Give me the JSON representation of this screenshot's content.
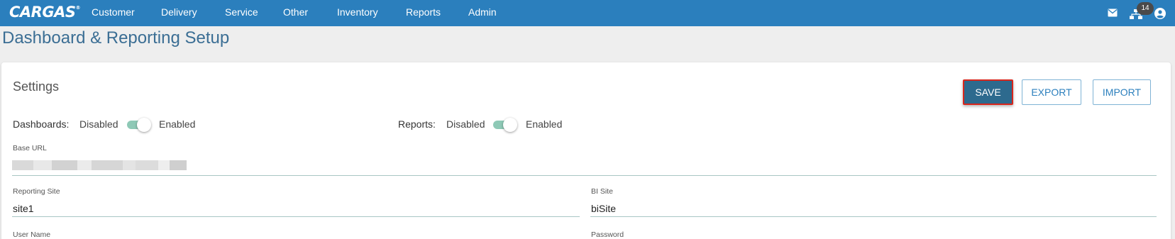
{
  "brand": {
    "name": "CARGAS",
    "mark": "®"
  },
  "nav": [
    {
      "label": "Customer"
    },
    {
      "label": "Delivery"
    },
    {
      "label": "Service"
    },
    {
      "label": "Other"
    },
    {
      "label": "Inventory"
    },
    {
      "label": "Reports"
    },
    {
      "label": "Admin"
    }
  ],
  "topbar": {
    "notification_count": "14",
    "icons": [
      "mail-icon",
      "sitemap-icon",
      "account-circle-icon"
    ]
  },
  "page": {
    "title": "Dashboard & Reporting Setup"
  },
  "settings": {
    "title": "Settings",
    "buttons": {
      "save": "SAVE",
      "export": "EXPORT",
      "import": "IMPORT"
    },
    "dashboards": {
      "label": "Dashboards:",
      "off": "Disabled",
      "on": "Enabled",
      "enabled": true
    },
    "reports": {
      "label": "Reports:",
      "off": "Disabled",
      "on": "Enabled",
      "enabled": true
    },
    "fields": {
      "base_url": {
        "label": "Base URL",
        "value": ""
      },
      "reporting_site": {
        "label": "Reporting Site",
        "value": "site1"
      },
      "bi_site": {
        "label": "BI Site",
        "value": "biSite"
      },
      "user_name": {
        "label": "User Name",
        "value": ""
      },
      "password": {
        "label": "Password",
        "value": ""
      }
    }
  },
  "colors": {
    "topbar": "#2b7fbd",
    "title": "#3b6e94",
    "save_button": "#2d6a8e",
    "highlight_border": "#d9261c",
    "toggle_track": "#8ec9b6"
  }
}
